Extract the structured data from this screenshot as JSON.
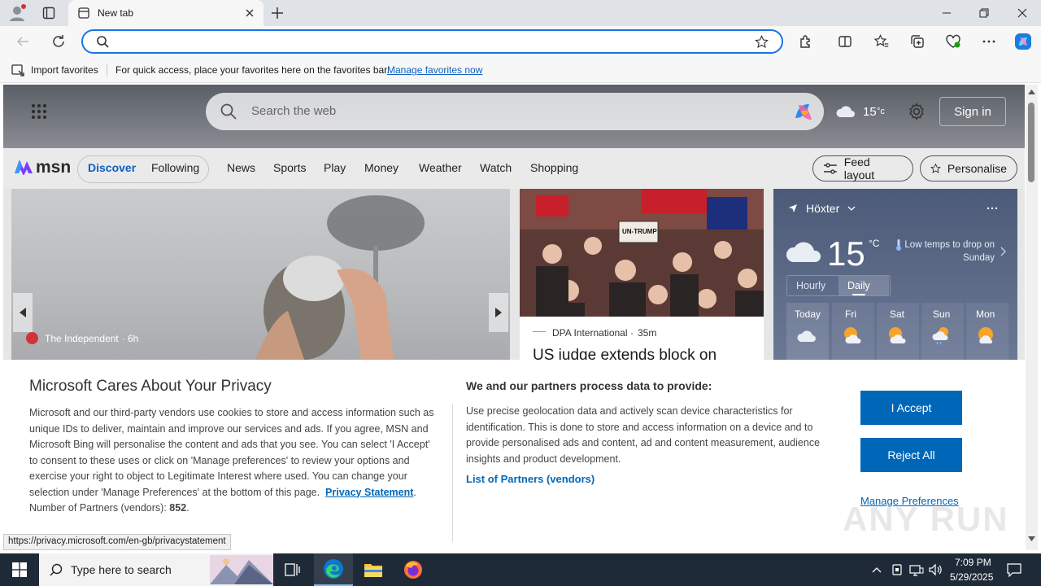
{
  "browser": {
    "tab_title": "New tab",
    "address_value": "",
    "favorites": {
      "import_label": "Import favorites",
      "hint": "For quick access, place your favorites here on the favorites bar.",
      "manage_link": "Manage favorites now"
    }
  },
  "msn": {
    "search_placeholder": "Search the web",
    "header_temp": "15",
    "header_unit": "°c",
    "signin_label": "Sign in",
    "logo_text": "msn",
    "tabs": [
      {
        "label": "Discover"
      },
      {
        "label": "Following"
      }
    ],
    "nav": [
      "News",
      "Sports",
      "Play",
      "Money",
      "Weather",
      "Watch",
      "Shopping"
    ],
    "feed_layout_label": "Feed layout",
    "personalise_label": "Personalise",
    "hero": {
      "source": "The Independent",
      "age": "6h"
    },
    "news2": {
      "source": "DPA International",
      "age": "35m",
      "headline": "US judge extends block on",
      "sign_text": "UN-TRUMP"
    },
    "weather": {
      "location": "Höxter",
      "temp": "15",
      "unit": "°C",
      "note": "Low temps to drop on Sunday",
      "tab_hourly": "Hourly",
      "tab_daily": "Daily",
      "days": [
        "Today",
        "Fri",
        "Sat",
        "Sun",
        "Mon"
      ]
    }
  },
  "privacy": {
    "title": "Microsoft Cares About Your Privacy",
    "body": "Microsoft and our third-party vendors use cookies to store and access information such as unique IDs to deliver, maintain and improve our services and ads. If you agree, MSN and Microsoft Bing will personalise the content and ads that you see. You can select 'I Accept' to consent to these uses or click on 'Manage preferences' to review your options and exercise your right to object to Legitimate Interest where used.  You can change your selection under 'Manage Preferences' at the bottom of this page.",
    "privacy_link": "Privacy Statement",
    "partners_label": "Number of Partners (vendors):",
    "partners_count": "852",
    "right_title": "We and our partners process data to provide:",
    "right_body": "Use precise geolocation data and actively scan device characteristics for identification. This is done to store and access information on a device and to provide personalised ads and content, ad and content measurement, audience insights and product development.",
    "partners_link": "List of Partners (vendors)",
    "accept_label": "I Accept",
    "reject_label": "Reject All",
    "manage_label": "Manage Preferences"
  },
  "status_url": "https://privacy.microsoft.com/en-gb/privacystatement",
  "watermark": "ANY RUN",
  "taskbar": {
    "search_placeholder": "Type here to search",
    "time": "7:09 PM",
    "date": "5/29/2025"
  },
  "colors": {
    "accent": "#0067b8",
    "focus_border": "#1a73e8"
  }
}
